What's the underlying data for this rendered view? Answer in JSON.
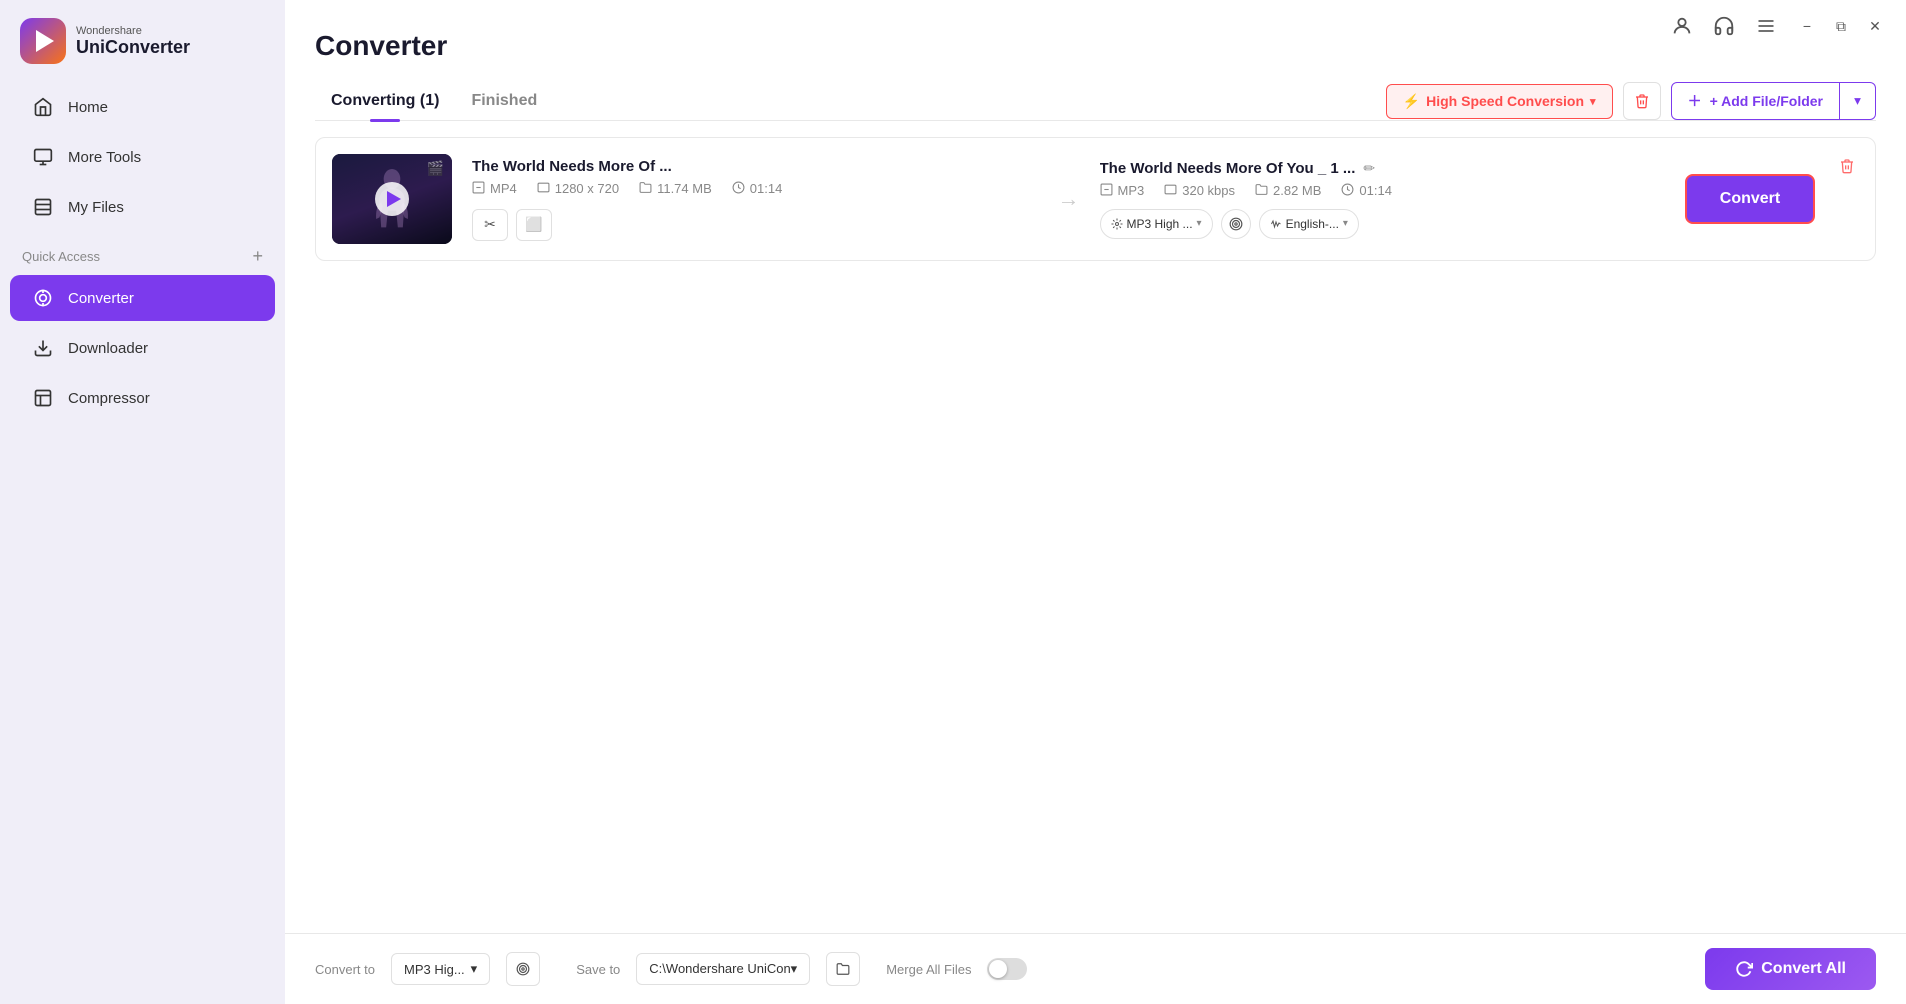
{
  "app": {
    "brand": "Wondershare",
    "name": "UniConverter"
  },
  "titlebar": {
    "profile_icon": "👤",
    "headset_icon": "🎧",
    "menu_icon": "☰",
    "minimize_label": "−",
    "restore_label": "⧉",
    "close_label": "✕"
  },
  "sidebar": {
    "nav_items": [
      {
        "id": "home",
        "label": "Home",
        "icon": "🏠"
      },
      {
        "id": "more-tools",
        "label": "More Tools",
        "icon": "🖥"
      },
      {
        "id": "my-files",
        "label": "My Files",
        "icon": "📋"
      }
    ],
    "quick_access_label": "Quick Access",
    "quick_access_plus": "+",
    "bottom_items": [
      {
        "id": "converter",
        "label": "Converter",
        "icon": "🔄",
        "active": true
      },
      {
        "id": "downloader",
        "label": "Downloader",
        "icon": "📥"
      },
      {
        "id": "compressor",
        "label": "Compressor",
        "icon": "🗜"
      }
    ]
  },
  "page": {
    "title": "Converter"
  },
  "tabs": {
    "converting": "Converting (1)",
    "finished": "Finished"
  },
  "toolbar": {
    "high_speed_label": "High Speed Conversion",
    "high_speed_icon": "⚡",
    "delete_icon": "🗑",
    "add_file_label": "+ Add File/Folder",
    "add_file_arrow": "▾"
  },
  "file_card": {
    "source_name": "The World Needs More Of ...",
    "source_format": "MP4",
    "source_resolution": "1280 x 720",
    "source_size": "11.74 MB",
    "source_duration": "01:14",
    "cut_icon": "✂",
    "copy_icon": "⬜",
    "output_name": "The World Needs More Of You _ 1 ...",
    "edit_icon": "✏",
    "output_format": "MP3",
    "output_bitrate": "320 kbps",
    "output_size": "2.82 MB",
    "output_duration": "01:14",
    "quality_label": "MP3 High ...",
    "target_icon": "🎯",
    "language_icon": "📊",
    "language_label": "English-...",
    "convert_label": "Convert",
    "delete_card_icon": "🗑"
  },
  "bottom_bar": {
    "convert_to_label": "Convert to",
    "format_value": "MP3 Hig...",
    "settings_icon": "🎯",
    "save_to_label": "Save to",
    "path_value": "C:\\Wondershare UniCon▾",
    "folder_icon": "📁",
    "merge_label": "Merge All Files",
    "convert_all_icon": "🔄",
    "convert_all_label": "Convert All"
  }
}
